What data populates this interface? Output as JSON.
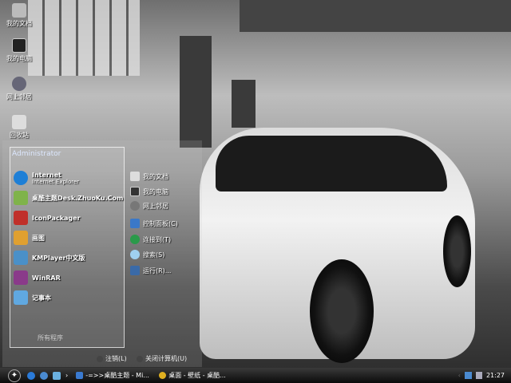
{
  "desktop_icons": [
    {
      "label": "我的文档",
      "icon": "my-documents-icon"
    },
    {
      "label": "我的电脑",
      "icon": "my-computer-icon"
    },
    {
      "label": "网上邻居",
      "icon": "network-places-icon"
    },
    {
      "label": "回收站",
      "icon": "recycle-bin-icon"
    }
  ],
  "start_menu": {
    "user": "Administrator",
    "programs": [
      {
        "label": "Internet",
        "sub": "Internet Explorer",
        "color": "#1e7fd6"
      },
      {
        "label": "桌酷主题Desk.ZhuoKu.Com",
        "color": "#7fb34a"
      },
      {
        "label": "IconPackager",
        "color": "#c0302a"
      },
      {
        "label": "画图",
        "color": "#e0a030"
      },
      {
        "label": "KMPlayer中文版",
        "color": "#4a90c8"
      },
      {
        "label": "WinRAR",
        "color": "#8a3a8a"
      },
      {
        "label": "记事本",
        "color": "#60a8e0"
      }
    ],
    "all_programs": "所有程序",
    "places": [
      {
        "label": "我的文档",
        "color": "#ddd"
      },
      {
        "label": "我的电脑",
        "color": "#333"
      },
      {
        "label": "网上邻居",
        "color": "#777"
      },
      {
        "label": "控制面板(C)",
        "color": "#3a78c8"
      },
      {
        "label": "连接到(T)",
        "color": "#2a9a4a"
      },
      {
        "label": "搜索(S)",
        "color": "#9fd0f0"
      },
      {
        "label": "运行(R)...",
        "color": "#3a6aa8"
      }
    ],
    "logoff": "注销(L)",
    "shutdown": "关闭计算机(U)"
  },
  "taskbar": {
    "tasks": [
      {
        "label": "-=>>桌酷主题 - Mi...",
        "color": "#3a7ad0"
      },
      {
        "label": "桌面 - 壁纸 - 桌酷...",
        "color": "#e0b020"
      }
    ],
    "clock": "21:27"
  }
}
